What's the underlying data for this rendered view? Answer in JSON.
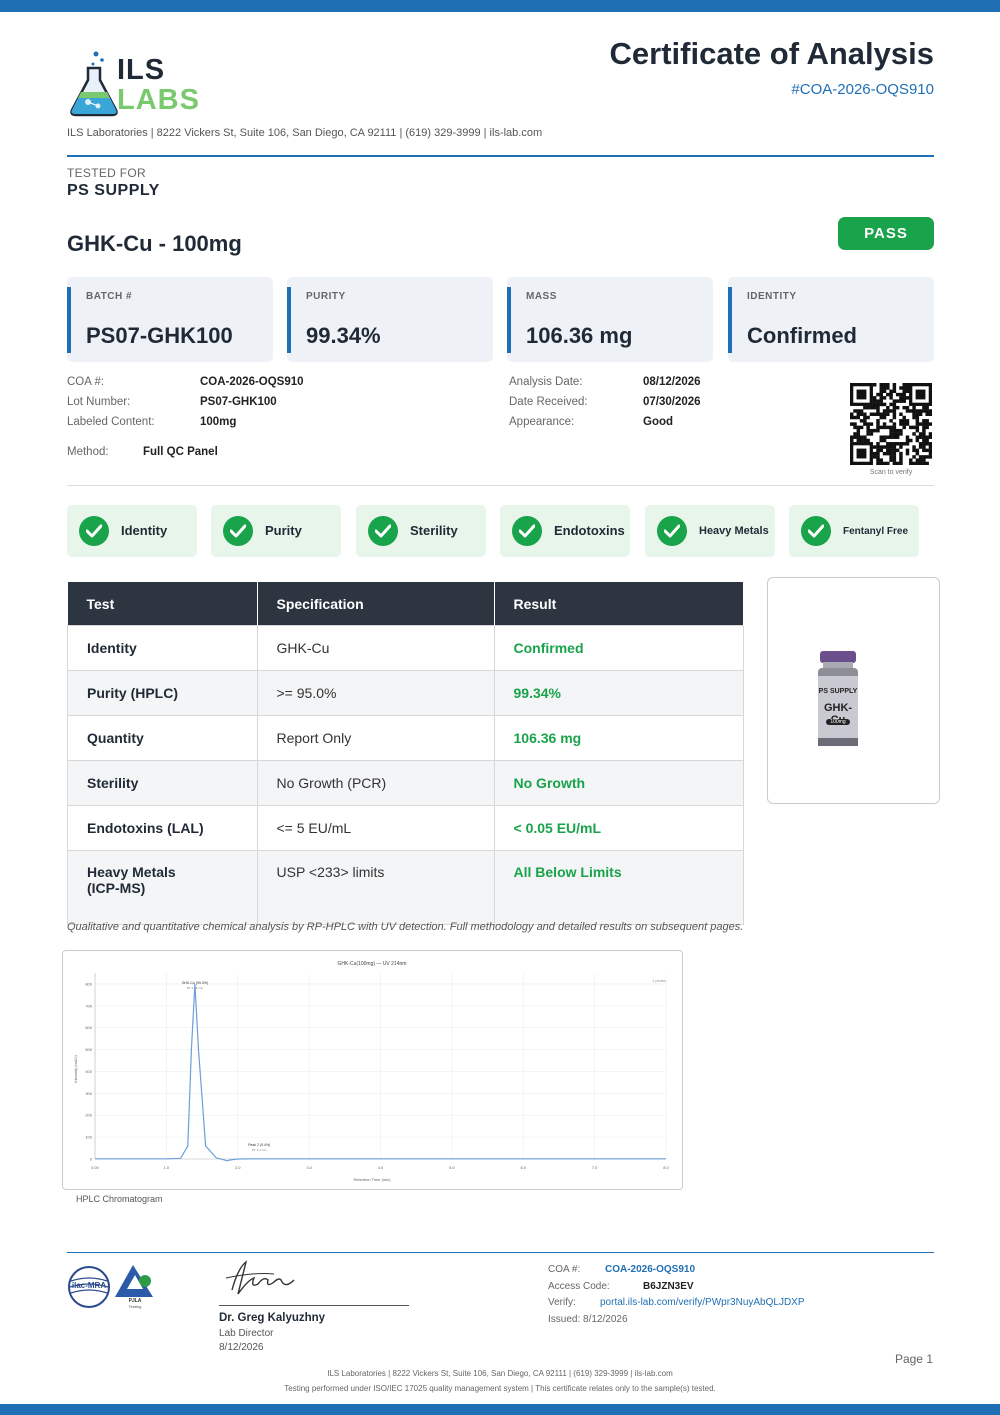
{
  "header": {
    "logo_line1": "ILS",
    "logo_line2": "LABS",
    "title": "Certificate of Analysis",
    "coa_number": "#COA-2026-OQS910",
    "address": "ILS Laboratories  |  8222 Vickers St, Suite 106, San Diego, CA 92111  |  (619) 329-3999  |  ils-lab.com"
  },
  "client": {
    "label": "TESTED FOR",
    "name": "PS SUPPLY"
  },
  "product": {
    "name": "GHK-Cu - 100mg",
    "status": "PASS"
  },
  "summary_cards": [
    {
      "label": "BATCH #",
      "value": "PS07-GHK100"
    },
    {
      "label": "PURITY",
      "value": "99.34%"
    },
    {
      "label": "MASS",
      "value": "106.36 mg"
    },
    {
      "label": "IDENTITY",
      "value": "Confirmed"
    }
  ],
  "meta_left": [
    {
      "label": "COA #:",
      "value": "COA-2026-OQS910"
    },
    {
      "label": "Lot Number:",
      "value": "PS07-GHK100"
    },
    {
      "label": "Labeled Content:",
      "value": "100mg"
    }
  ],
  "method": {
    "label": "Method:",
    "value": "Full QC Panel"
  },
  "meta_right": [
    {
      "label": "Analysis Date:",
      "value": "08/12/2026"
    },
    {
      "label": "Date Received:",
      "value": "07/30/2026"
    },
    {
      "label": "Appearance:",
      "value": "Good"
    }
  ],
  "qr_caption": "Scan to verify",
  "checks": [
    "Identity",
    "Purity",
    "Sterility",
    "Endotoxins",
    "Heavy Metals",
    "Fentanyl Free"
  ],
  "results_table": {
    "headers": [
      "Test",
      "Specification",
      "Result"
    ],
    "rows": [
      {
        "test": "Identity",
        "spec": "GHK-Cu",
        "result": "Confirmed"
      },
      {
        "test": "Purity (HPLC)",
        "spec": ">= 95.0%",
        "result": "99.34%"
      },
      {
        "test": "Quantity",
        "spec": "Report Only",
        "result": "106.36 mg"
      },
      {
        "test": "Sterility",
        "spec": "No Growth (PCR)",
        "result": "No Growth"
      },
      {
        "test": "Endotoxins (LAL)",
        "spec": "<= 5 EU/mL",
        "result": "< 0.05 EU/mL"
      },
      {
        "test": "Heavy Metals (ICP-MS)",
        "spec": "USP <233> limits",
        "result": "All Below Limits"
      }
    ]
  },
  "vial": {
    "brand": "PS SUPPLY",
    "name": "GHK-Cu",
    "dose": "100mg"
  },
  "method_note": "Qualitative and quantitative chemical analysis by RP-HPLC with UV detection. Full methodology and detailed results on subsequent pages.",
  "chromatogram": {
    "caption": "HPLC Chromatogram",
    "chart_data": {
      "type": "line",
      "title": "GHK-Cu(100mg) — UV 214nm",
      "xlabel": "Retention Time (min)",
      "ylabel": "Intensity (mAU)",
      "x_ticks": [
        "0.00",
        "1.0",
        "2.0",
        "3.0",
        "4.0",
        "5.0",
        "6.0",
        "7.0",
        "8.0"
      ],
      "y_ticks": [
        "0",
        "100",
        "200",
        "300",
        "400",
        "500",
        "600",
        "700",
        "800"
      ],
      "xlim": [
        0,
        8
      ],
      "ylim": [
        0,
        850
      ],
      "series": [
        {
          "x": [
            0,
            1.0,
            1.2,
            1.3,
            1.35,
            1.4,
            1.45,
            1.55,
            1.7,
            1.8,
            1.85,
            1.9,
            2.0,
            2.2,
            2.3,
            2.4,
            2.6,
            3.0,
            4.0,
            5.0,
            6.0,
            7.0,
            8.0
          ],
          "y": [
            1,
            1,
            3,
            60,
            500,
            800,
            500,
            60,
            5,
            -3,
            -8,
            -4,
            0,
            1,
            1,
            1,
            1,
            1,
            1,
            1,
            1,
            1,
            1
          ]
        }
      ],
      "annotations": [
        {
          "x": 1.4,
          "text": "GHK-Cu (99.3%)",
          "sub": "RT 1.38 min"
        },
        {
          "x": 2.3,
          "text": "Peak 2 (0.4%)",
          "sub": "RT 2.3 min"
        }
      ],
      "corner_label": "1 peaks"
    }
  },
  "signature": {
    "name": "Dr. Greg Kalyuzhny",
    "role": "Lab Director",
    "date": "8/12/2026"
  },
  "accreditation": {
    "ilac": "ilac-MRA",
    "pjla": "PJLA",
    "pjla_sub": "Testing"
  },
  "footer_info": {
    "coa_label": "COA #:",
    "coa_value": "COA-2026-OQS910",
    "access_label": "Access Code:",
    "access_value": "B6JZN3EV",
    "verify_label": "Verify:",
    "verify_value": "portal.ils-lab.com/verify/PWpr3NuyAbQLJDXP",
    "issued": "Issued: 8/12/2026"
  },
  "page_label": "Page 1",
  "footer_line1": "ILS Laboratories  |  8222 Vickers St, Suite 106, San Diego, CA 92111  |  (619) 329-3999  |  ils-lab.com",
  "footer_line2": "Testing performed under ISO/IEC 17025 quality management system  |  This certificate relates only to the sample(s) tested."
}
